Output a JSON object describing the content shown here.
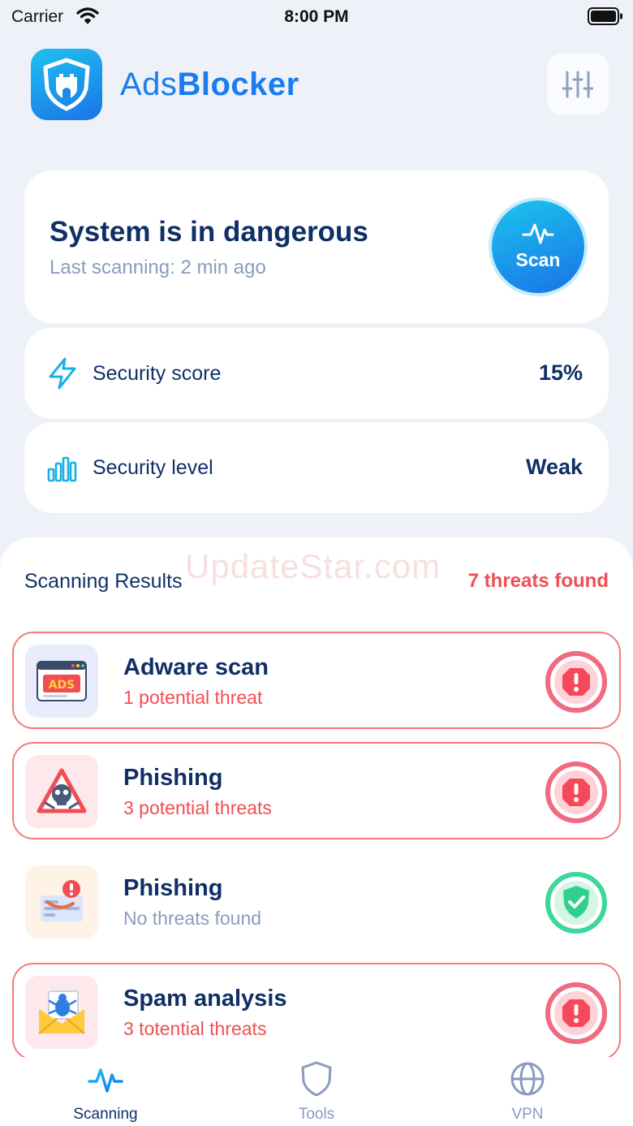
{
  "status_bar": {
    "carrier": "Carrier",
    "time": "8:00 PM"
  },
  "header": {
    "brand_light": "Ads",
    "brand_bold": "Blocker"
  },
  "status_card": {
    "headline": "System is in dangerous",
    "last_scan": "Last scanning: 2 min ago",
    "scan_label": "Scan"
  },
  "metrics": {
    "score": {
      "label": "Security score",
      "value": "15%"
    },
    "level": {
      "label": "Security level",
      "value": "Weak"
    }
  },
  "results": {
    "title": "Scanning Results",
    "count": "7 threats found",
    "watermark": "UpdateStar.com",
    "items": [
      {
        "name": "Adware scan",
        "desc": "1 potential threat",
        "state": "danger"
      },
      {
        "name": "Phishing",
        "desc": "3 potential threats",
        "state": "danger"
      },
      {
        "name": "Phishing",
        "desc": "No threats found",
        "state": "safe"
      },
      {
        "name": "Spam analysis",
        "desc": "3 totential threats",
        "state": "danger"
      }
    ]
  },
  "tabs": [
    {
      "label": "Scanning",
      "active": true
    },
    {
      "label": "Tools",
      "active": false
    },
    {
      "label": "VPN",
      "active": false
    }
  ],
  "colors": {
    "accent": "#1b7cf0",
    "danger": "#f04e53",
    "safe": "#2fd08e",
    "navy": "#0f2f66"
  }
}
